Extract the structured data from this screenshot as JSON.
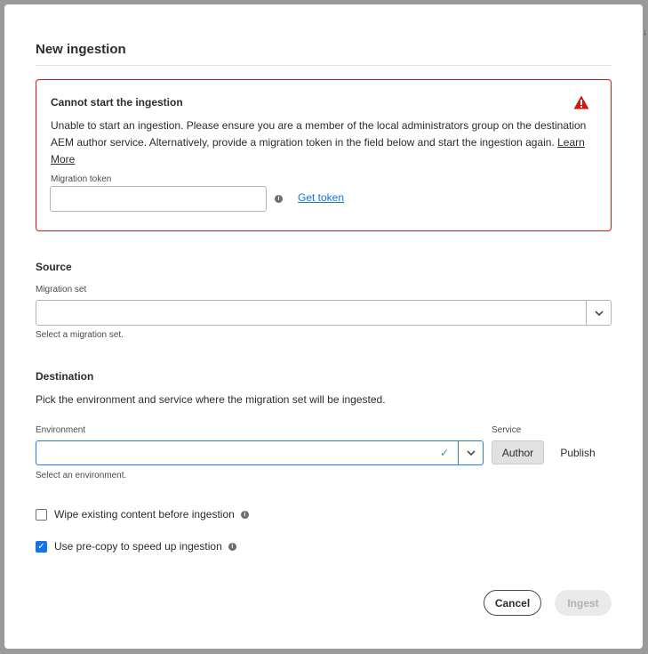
{
  "dialog": {
    "title": "New ingestion"
  },
  "alert": {
    "heading": "Cannot start the ingestion",
    "body": "Unable to start an ingestion. Please ensure you are a member of the local administrators group on the destination AEM author service. Alternatively, provide a migration token in the field below and start the ingestion again.",
    "learn_more": "Learn More",
    "token_label": "Migration token",
    "token_value": "",
    "get_token": "Get token",
    "color": "#d31510"
  },
  "source": {
    "heading": "Source",
    "migration_set_label": "Migration set",
    "migration_set_value": "",
    "help": "Select a migration set."
  },
  "destination": {
    "heading": "Destination",
    "description": "Pick the environment and service where the migration set will be ingested.",
    "environment_label": "Environment",
    "environment_value": "",
    "environment_help": "Select an environment.",
    "service_label": "Service",
    "services": [
      "Author",
      "Publish"
    ],
    "selected_service": "Author"
  },
  "options": {
    "wipe_label": "Wipe existing content before ingestion",
    "wipe_checked": false,
    "precopy_label": "Use pre-copy to speed up ingestion",
    "precopy_checked": true
  },
  "footer": {
    "cancel": "Cancel",
    "ingest": "Ingest"
  }
}
